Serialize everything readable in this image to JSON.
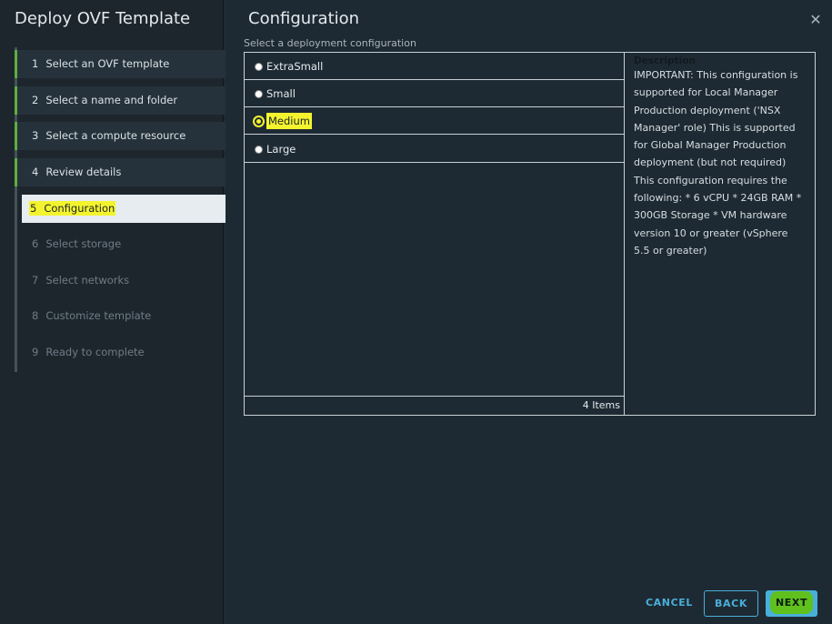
{
  "wizard": {
    "title": "Deploy OVF Template",
    "steps": [
      {
        "num": "1",
        "label": "Select an OVF template",
        "state": "done"
      },
      {
        "num": "2",
        "label": "Select a name and folder",
        "state": "done"
      },
      {
        "num": "3",
        "label": "Select a compute resource",
        "state": "done"
      },
      {
        "num": "4",
        "label": "Review details",
        "state": "done"
      },
      {
        "num": "5",
        "label": "Configuration",
        "state": "current"
      },
      {
        "num": "6",
        "label": "Select storage",
        "state": "pending"
      },
      {
        "num": "7",
        "label": "Select networks",
        "state": "pending"
      },
      {
        "num": "8",
        "label": "Customize template",
        "state": "pending"
      },
      {
        "num": "9",
        "label": "Ready to complete",
        "state": "pending"
      }
    ]
  },
  "main": {
    "title": "Configuration",
    "close_icon": "close-icon",
    "subtitle": "Select a deployment configuration",
    "options": [
      {
        "label": "ExtraSmall",
        "selected": false
      },
      {
        "label": "Small",
        "selected": false
      },
      {
        "label": "Medium",
        "selected": true
      },
      {
        "label": "Large",
        "selected": false
      }
    ],
    "items_count": "4 Items",
    "description": {
      "heading": "Description",
      "text": "IMPORTANT: This configuration is supported for Local Manager Production deployment ('NSX Manager' role) This is supported for Global Manager Production deployment (but not required) This configuration requires the following: * 6 vCPU * 24GB RAM * 300GB Storage * VM hardware version 10 or greater (vSphere 5.5 or greater)"
    }
  },
  "buttons": {
    "cancel": "CANCEL",
    "back": "BACK",
    "next": "NEXT"
  },
  "colors": {
    "accent": "#49afd9",
    "done_bar": "#5fae3e",
    "highlight": "#f4f42e"
  }
}
